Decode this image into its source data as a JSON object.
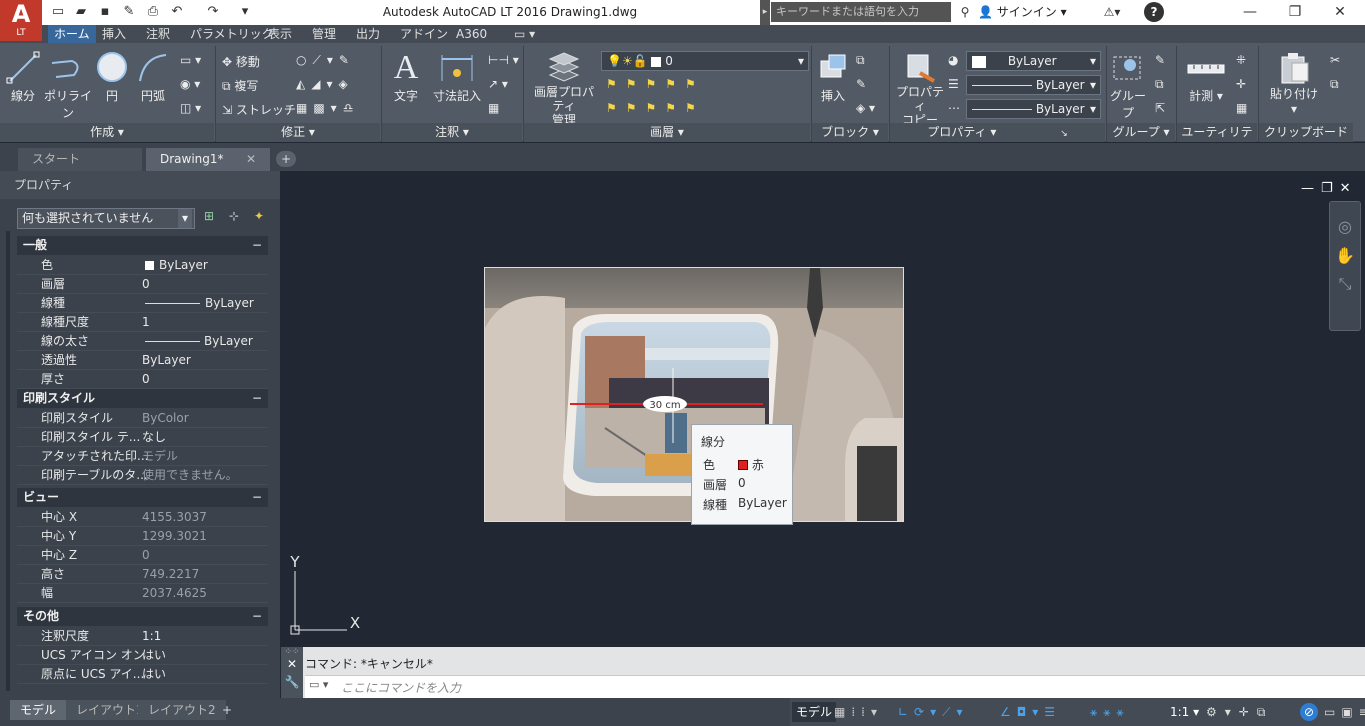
{
  "app": {
    "logo_text": "A",
    "logo_sub": "LT",
    "title": "Autodesk AutoCAD LT 2016    Drawing1.dwg",
    "search_placeholder": "キーワードまたは語句を入力",
    "signin": "サインイン"
  },
  "tabs": [
    "ホーム",
    "挿入",
    "注釈",
    "パラメトリック",
    "表示",
    "管理",
    "出力",
    "アドイン",
    "A360"
  ],
  "ribbon": {
    "draw": {
      "title": "作成",
      "line": "線分",
      "polyline": "ポリライン",
      "circle": "円",
      "arc": "円弧"
    },
    "modify": {
      "title": "修正",
      "move": "移動",
      "copy": "複写",
      "stretch": "ストレッチ"
    },
    "annotation": {
      "title": "注釈",
      "text": "文字",
      "dimension": "寸法記入"
    },
    "layers": {
      "title": "画層",
      "layer_props": "画層プロパティ\n管理",
      "current_layer": "0"
    },
    "block": {
      "title": "ブロック",
      "insert": "挿入"
    },
    "properties": {
      "title": "プロパティ",
      "match": "プロパティ\nコピー",
      "color": "ByLayer",
      "linetype": "ByLayer",
      "lineweight": "ByLayer"
    },
    "groups": {
      "title": "グループ",
      "group": "グループ"
    },
    "utilities": {
      "title": "ユーティリティ",
      "measure": "計測"
    },
    "clipboard": {
      "title": "クリップボード",
      "paste": "貼り付け"
    }
  },
  "doctabs": {
    "start": "スタート",
    "drawing": "Drawing1*"
  },
  "props": {
    "title": "プロパティ",
    "selection": "何も選択されていません",
    "sections": [
      {
        "name": "一般",
        "rows": [
          [
            "色",
            "ByLayer"
          ],
          [
            "画層",
            "0"
          ],
          [
            "線種",
            "ByLayer"
          ],
          [
            "線種尺度",
            "1"
          ],
          [
            "線の太さ",
            "ByLayer"
          ],
          [
            "透過性",
            "ByLayer"
          ],
          [
            "厚さ",
            "0"
          ]
        ]
      },
      {
        "name": "印刷スタイル",
        "rows": [
          [
            "印刷スタイル",
            "ByColor"
          ],
          [
            "印刷スタイル テ...",
            "なし"
          ],
          [
            "アタッチされた印...",
            "モデル"
          ],
          [
            "印刷テーブルのタ...",
            "使用できません。"
          ]
        ]
      },
      {
        "name": "ビュー",
        "rows": [
          [
            "中心 X",
            "4155.3037"
          ],
          [
            "中心 Y",
            "1299.3021"
          ],
          [
            "中心 Z",
            "0"
          ],
          [
            "高さ",
            "749.2217"
          ],
          [
            "幅",
            "2037.4625"
          ]
        ]
      },
      {
        "name": "その他",
        "rows": [
          [
            "注釈尺度",
            "1:1"
          ],
          [
            "UCS アイコン オン",
            "はい"
          ],
          [
            "原点に UCS アイ...",
            "はい"
          ]
        ]
      }
    ]
  },
  "canvas": {
    "dim_label": "30 cm",
    "ucs_x": "X",
    "ucs_y": "Y"
  },
  "tooltip": {
    "title": "線分",
    "rows": [
      [
        "色",
        "赤"
      ],
      [
        "画層",
        "0"
      ],
      [
        "線種",
        "ByLayer"
      ]
    ],
    "swatch": "#e02020"
  },
  "command": {
    "history": "コマンド:  *キャンセル*",
    "placeholder": "ここにコマンドを入力"
  },
  "layout_tabs": [
    "モデル",
    "レイアウト1",
    "レイアウト2"
  ],
  "status": {
    "model": "モデル",
    "scale": "1:1"
  }
}
